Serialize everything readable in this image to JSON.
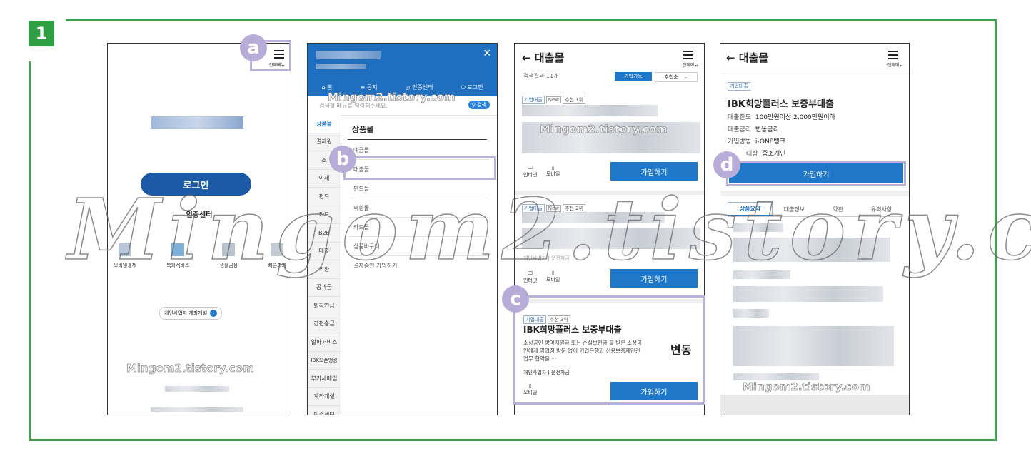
{
  "step": "1",
  "watermark": "Mingom2.tistory.com",
  "markers": [
    "a",
    "b",
    "c",
    "d"
  ],
  "colors": {
    "frame": "#3aa34a",
    "accent": "#1f77c9",
    "highlight": "#b9b0db",
    "login": "#1d5aa6"
  },
  "screen1": {
    "menu_label": "전체메뉴",
    "login_button": "로그인",
    "auth_center": "인증센터",
    "quick_items": [
      "모바일결제",
      "특화서비스",
      "생활금융",
      "빠른조회"
    ],
    "business_link": "개인사업자 계좌개설"
  },
  "screen2": {
    "close": "✕",
    "nav": [
      "홈",
      "공지",
      "인증센터",
      "로그인"
    ],
    "search_placeholder": "검색할 메뉴를 입력해주세요.",
    "search_button": "검색",
    "sidebar": [
      "상품몰",
      "결제원",
      "조",
      "이체",
      "펀드",
      "카드",
      "B2B",
      "대출",
      "외환",
      "공과금",
      "퇴직연금",
      "간편송금",
      "알파서비스",
      "IBK오픈뱅킹",
      "부가세매입",
      "계좌개설",
      "인증센터"
    ],
    "section_title": "상품몰",
    "menu_items": [
      "예금몰",
      "대출몰",
      "펀드몰",
      "외환몰",
      "카드몰",
      "상품바구니",
      "결재승인 가입하기"
    ]
  },
  "screen3": {
    "back_title": "← 대출몰",
    "menu_label": "전체메뉴",
    "result_count": "검색결과 11개",
    "filter_active": "가입가능",
    "filter_sort": "추천순",
    "card1": {
      "tags": [
        "기업대출",
        "New",
        "추천 1위"
      ],
      "channels": [
        "인터넷",
        "모바일"
      ],
      "button": "가입하기"
    },
    "card2": {
      "tags": [
        "기업대출",
        "New",
        "추천 2위"
      ],
      "meta": "개인사업자 | 운전자금",
      "channels": [
        "인터넷",
        "모바일"
      ],
      "button": "가입하기"
    },
    "card3": {
      "tags": [
        "기업대출",
        "추천 3위"
      ],
      "title": "IBK희망플러스 보증부대출",
      "desc": "소상공인 방역지원금 또는 손실보전금 을 받은 소상공인에게 영업점 방문 없이 기업은행과 신용보증재단간 업무 협약을 ···",
      "rate": "변동",
      "meta_left": "개인사업자",
      "meta_right": "운전자금",
      "channel": "모바일",
      "button": "가입하기"
    }
  },
  "screen4": {
    "back_title": "← 대출몰",
    "menu_label": "전체메뉴",
    "tag": "기업대출",
    "title": "IBK희망플러스 보증부대출",
    "rows": [
      {
        "label": "대출한도",
        "value": "100만원이상 2,000만원이하"
      },
      {
        "label": "대출금리",
        "value": "변동금리"
      },
      {
        "label": "가입방법",
        "value": "i-ONE뱅크"
      },
      {
        "label": "대상",
        "value": "중소개인"
      }
    ],
    "join_button": "가입하기",
    "tabs": [
      "상품요약",
      "대출정보",
      "약관",
      "유의사항"
    ]
  }
}
